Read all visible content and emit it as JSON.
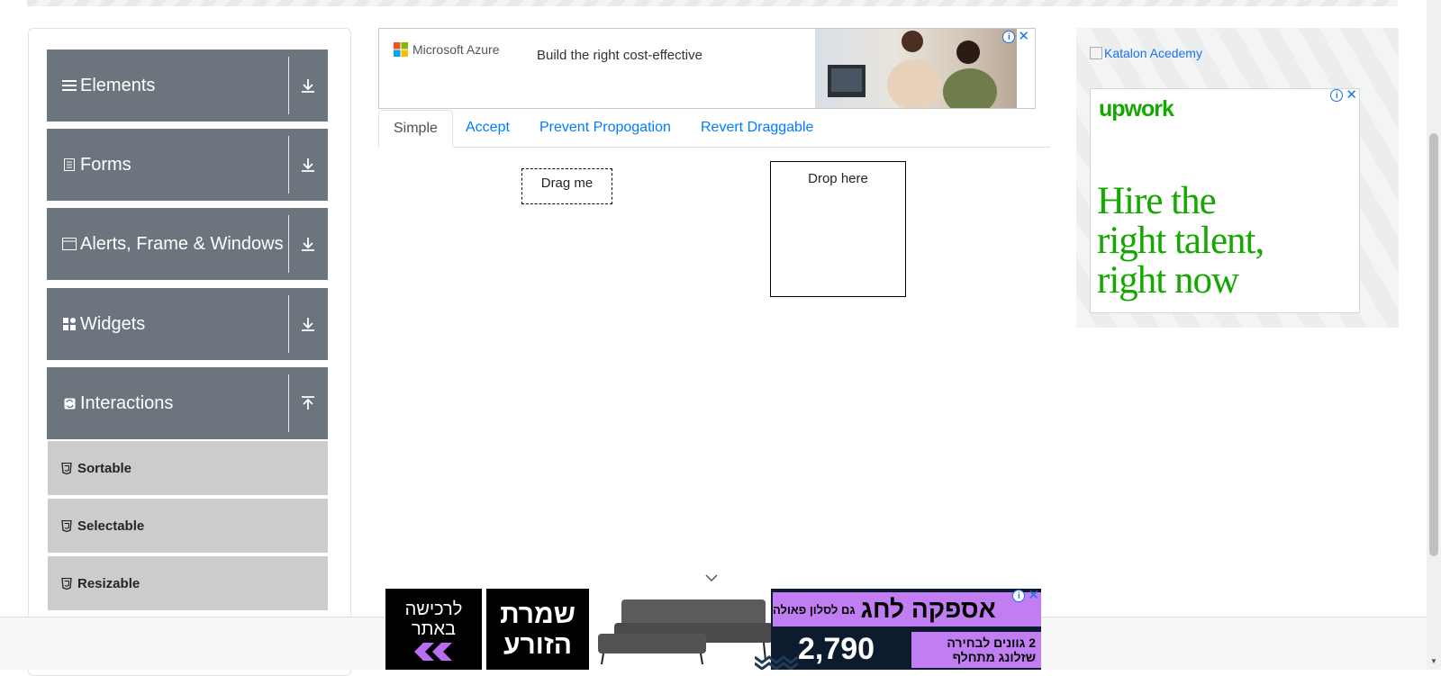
{
  "sidebar": {
    "groups": [
      {
        "label": "Elements",
        "icon": "list-icon"
      },
      {
        "label": "Forms",
        "icon": "document-icon"
      },
      {
        "label": "Alerts, Frame & Windows",
        "icon": "window-icon"
      },
      {
        "label": "Widgets",
        "icon": "grid-icon"
      },
      {
        "label": "Interactions",
        "icon": "sync-icon"
      }
    ],
    "interactions_items": [
      "Sortable",
      "Selectable",
      "Resizable"
    ]
  },
  "ad_top": {
    "brand": "Microsoft Azure",
    "text": "Build the right cost-effective"
  },
  "tabs": [
    "Simple",
    "Accept",
    "Prevent Propogation",
    "Revert Draggable"
  ],
  "active_tab": "Simple",
  "draggable": {
    "label": "Drag me"
  },
  "droppable": {
    "label": "Drop here"
  },
  "right_ad": {
    "katalon_alt": "Katalon Acedemy",
    "upwork_logo": "upwork",
    "upwork_headline_1": "Hire the",
    "upwork_headline_2": "right talent,",
    "upwork_headline_3": "right now"
  },
  "bottom_ad": {
    "left_text_1": "לרכישה",
    "left_text_2": "באתר",
    "brand_1": "שמרת",
    "brand_2": "הזורע",
    "headline_big": "אספקה לחג",
    "headline_small": "גם לסלון פאולה",
    "price": "2,790",
    "sub_1": "2 גוונים לבחירה",
    "sub_2": "שזלונג מתחלף"
  },
  "colors": {
    "sidebar_header": "#6c757d",
    "sub_item": "#cccccc",
    "link": "#007bff",
    "upwork_green": "#14a800"
  }
}
